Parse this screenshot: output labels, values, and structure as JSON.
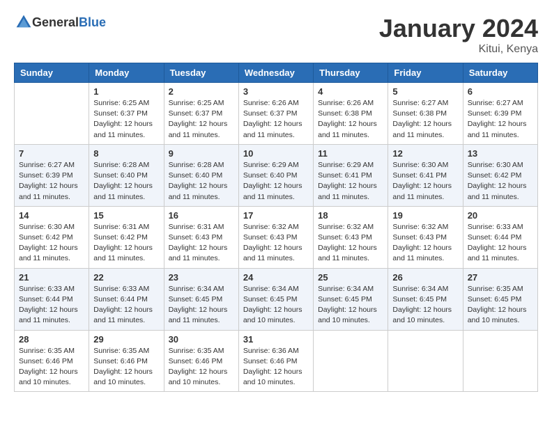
{
  "header": {
    "logo_general": "General",
    "logo_blue": "Blue",
    "month_title": "January 2024",
    "location": "Kitui, Kenya"
  },
  "days_of_week": [
    "Sunday",
    "Monday",
    "Tuesday",
    "Wednesday",
    "Thursday",
    "Friday",
    "Saturday"
  ],
  "weeks": [
    [
      {
        "day": "",
        "sunrise": "",
        "sunset": "",
        "daylight": ""
      },
      {
        "day": "1",
        "sunrise": "Sunrise: 6:25 AM",
        "sunset": "Sunset: 6:37 PM",
        "daylight": "Daylight: 12 hours and 11 minutes."
      },
      {
        "day": "2",
        "sunrise": "Sunrise: 6:25 AM",
        "sunset": "Sunset: 6:37 PM",
        "daylight": "Daylight: 12 hours and 11 minutes."
      },
      {
        "day": "3",
        "sunrise": "Sunrise: 6:26 AM",
        "sunset": "Sunset: 6:37 PM",
        "daylight": "Daylight: 12 hours and 11 minutes."
      },
      {
        "day": "4",
        "sunrise": "Sunrise: 6:26 AM",
        "sunset": "Sunset: 6:38 PM",
        "daylight": "Daylight: 12 hours and 11 minutes."
      },
      {
        "day": "5",
        "sunrise": "Sunrise: 6:27 AM",
        "sunset": "Sunset: 6:38 PM",
        "daylight": "Daylight: 12 hours and 11 minutes."
      },
      {
        "day": "6",
        "sunrise": "Sunrise: 6:27 AM",
        "sunset": "Sunset: 6:39 PM",
        "daylight": "Daylight: 12 hours and 11 minutes."
      }
    ],
    [
      {
        "day": "7",
        "sunrise": "Sunrise: 6:27 AM",
        "sunset": "Sunset: 6:39 PM",
        "daylight": "Daylight: 12 hours and 11 minutes."
      },
      {
        "day": "8",
        "sunrise": "Sunrise: 6:28 AM",
        "sunset": "Sunset: 6:40 PM",
        "daylight": "Daylight: 12 hours and 11 minutes."
      },
      {
        "day": "9",
        "sunrise": "Sunrise: 6:28 AM",
        "sunset": "Sunset: 6:40 PM",
        "daylight": "Daylight: 12 hours and 11 minutes."
      },
      {
        "day": "10",
        "sunrise": "Sunrise: 6:29 AM",
        "sunset": "Sunset: 6:40 PM",
        "daylight": "Daylight: 12 hours and 11 minutes."
      },
      {
        "day": "11",
        "sunrise": "Sunrise: 6:29 AM",
        "sunset": "Sunset: 6:41 PM",
        "daylight": "Daylight: 12 hours and 11 minutes."
      },
      {
        "day": "12",
        "sunrise": "Sunrise: 6:30 AM",
        "sunset": "Sunset: 6:41 PM",
        "daylight": "Daylight: 12 hours and 11 minutes."
      },
      {
        "day": "13",
        "sunrise": "Sunrise: 6:30 AM",
        "sunset": "Sunset: 6:42 PM",
        "daylight": "Daylight: 12 hours and 11 minutes."
      }
    ],
    [
      {
        "day": "14",
        "sunrise": "Sunrise: 6:30 AM",
        "sunset": "Sunset: 6:42 PM",
        "daylight": "Daylight: 12 hours and 11 minutes."
      },
      {
        "day": "15",
        "sunrise": "Sunrise: 6:31 AM",
        "sunset": "Sunset: 6:42 PM",
        "daylight": "Daylight: 12 hours and 11 minutes."
      },
      {
        "day": "16",
        "sunrise": "Sunrise: 6:31 AM",
        "sunset": "Sunset: 6:43 PM",
        "daylight": "Daylight: 12 hours and 11 minutes."
      },
      {
        "day": "17",
        "sunrise": "Sunrise: 6:32 AM",
        "sunset": "Sunset: 6:43 PM",
        "daylight": "Daylight: 12 hours and 11 minutes."
      },
      {
        "day": "18",
        "sunrise": "Sunrise: 6:32 AM",
        "sunset": "Sunset: 6:43 PM",
        "daylight": "Daylight: 12 hours and 11 minutes."
      },
      {
        "day": "19",
        "sunrise": "Sunrise: 6:32 AM",
        "sunset": "Sunset: 6:43 PM",
        "daylight": "Daylight: 12 hours and 11 minutes."
      },
      {
        "day": "20",
        "sunrise": "Sunrise: 6:33 AM",
        "sunset": "Sunset: 6:44 PM",
        "daylight": "Daylight: 12 hours and 11 minutes."
      }
    ],
    [
      {
        "day": "21",
        "sunrise": "Sunrise: 6:33 AM",
        "sunset": "Sunset: 6:44 PM",
        "daylight": "Daylight: 12 hours and 11 minutes."
      },
      {
        "day": "22",
        "sunrise": "Sunrise: 6:33 AM",
        "sunset": "Sunset: 6:44 PM",
        "daylight": "Daylight: 12 hours and 11 minutes."
      },
      {
        "day": "23",
        "sunrise": "Sunrise: 6:34 AM",
        "sunset": "Sunset: 6:45 PM",
        "daylight": "Daylight: 12 hours and 11 minutes."
      },
      {
        "day": "24",
        "sunrise": "Sunrise: 6:34 AM",
        "sunset": "Sunset: 6:45 PM",
        "daylight": "Daylight: 12 hours and 10 minutes."
      },
      {
        "day": "25",
        "sunrise": "Sunrise: 6:34 AM",
        "sunset": "Sunset: 6:45 PM",
        "daylight": "Daylight: 12 hours and 10 minutes."
      },
      {
        "day": "26",
        "sunrise": "Sunrise: 6:34 AM",
        "sunset": "Sunset: 6:45 PM",
        "daylight": "Daylight: 12 hours and 10 minutes."
      },
      {
        "day": "27",
        "sunrise": "Sunrise: 6:35 AM",
        "sunset": "Sunset: 6:45 PM",
        "daylight": "Daylight: 12 hours and 10 minutes."
      }
    ],
    [
      {
        "day": "28",
        "sunrise": "Sunrise: 6:35 AM",
        "sunset": "Sunset: 6:46 PM",
        "daylight": "Daylight: 12 hours and 10 minutes."
      },
      {
        "day": "29",
        "sunrise": "Sunrise: 6:35 AM",
        "sunset": "Sunset: 6:46 PM",
        "daylight": "Daylight: 12 hours and 10 minutes."
      },
      {
        "day": "30",
        "sunrise": "Sunrise: 6:35 AM",
        "sunset": "Sunset: 6:46 PM",
        "daylight": "Daylight: 12 hours and 10 minutes."
      },
      {
        "day": "31",
        "sunrise": "Sunrise: 6:36 AM",
        "sunset": "Sunset: 6:46 PM",
        "daylight": "Daylight: 12 hours and 10 minutes."
      },
      {
        "day": "",
        "sunrise": "",
        "sunset": "",
        "daylight": ""
      },
      {
        "day": "",
        "sunrise": "",
        "sunset": "",
        "daylight": ""
      },
      {
        "day": "",
        "sunrise": "",
        "sunset": "",
        "daylight": ""
      }
    ]
  ]
}
